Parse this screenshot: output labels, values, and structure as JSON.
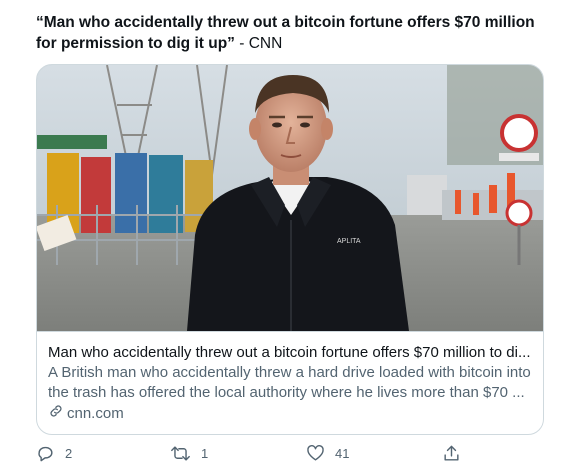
{
  "tweet": {
    "headline": "“Man who accidentally threw out a bitcoin fortune offers $70 million for permission to dig it up”",
    "source_suffix": " - CNN"
  },
  "card": {
    "image_alt": "Man in black jacket standing in front of a waste recycling site",
    "jacket_logo": "APLITA",
    "title": "Man who accidentally threw out a bitcoin fortune offers $70 million to di...",
    "description": "A British man who accidentally threw a hard drive loaded with bitcoin into the trash has offered the local authority where he lives more than $70 ...",
    "domain": "cnn.com"
  },
  "actions": {
    "reply_count": "2",
    "retweet_count": "1",
    "like_count": "41",
    "share_count": ""
  },
  "colors": {
    "text_primary": "#0f1419",
    "text_secondary": "#536471",
    "border": "#cfd9de"
  }
}
